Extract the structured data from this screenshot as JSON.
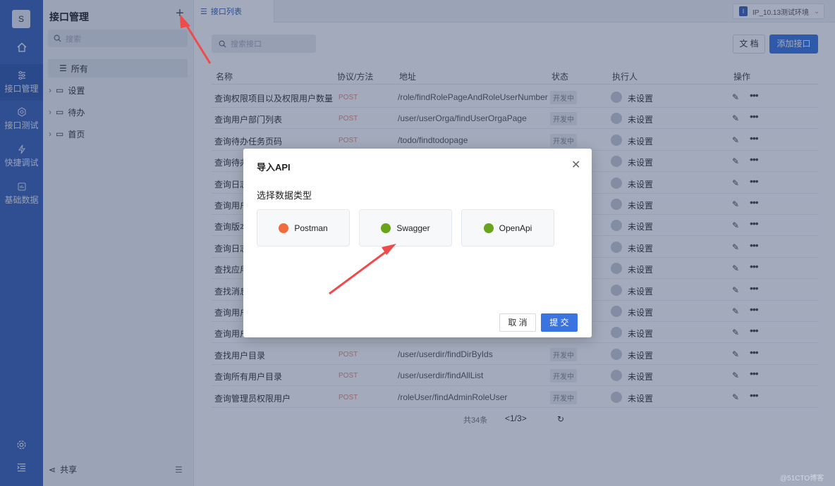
{
  "rail": {
    "avatar": "S",
    "items": [
      {
        "label": "接口管理",
        "icon": "sliders-icon"
      },
      {
        "label": "接口测试",
        "icon": "gear-box-icon"
      },
      {
        "label": "快捷调试",
        "icon": "lightning-icon"
      },
      {
        "label": "基础数据",
        "icon": "database-icon"
      }
    ]
  },
  "sidebar": {
    "title": "接口管理",
    "search_placeholder": "搜索",
    "all_label": "所有",
    "nodes": [
      "设置",
      "待办",
      "首页"
    ],
    "share_label": "共享"
  },
  "tabs": {
    "active": "接口列表",
    "env": "IP_10.13测试环境",
    "env_badge": "I"
  },
  "main": {
    "search_placeholder": "搜索接口",
    "doc_button": "文 档",
    "add_button": "添加接口",
    "columns": [
      "名称",
      "协议/方法",
      "地址",
      "状态",
      "执行人",
      "操作"
    ],
    "rows": [
      {
        "name": "查询权限项目以及权限用户数量",
        "method": "POST",
        "path": "/role/findRolePageAndRoleUserNumber",
        "status": "开发中",
        "executor": "未设置"
      },
      {
        "name": "查询用户部门列表",
        "method": "POST",
        "path": "/user/userOrga/findUserOrgaPage",
        "status": "开发中",
        "executor": "未设置"
      },
      {
        "name": "查询待办任务页码",
        "method": "POST",
        "path": "/todo/findtodopage",
        "status": "开发中",
        "executor": "未设置"
      },
      {
        "name": "查询待办",
        "method": "",
        "path": "",
        "status": "",
        "executor": "未设置"
      },
      {
        "name": "查询日志",
        "method": "",
        "path": "",
        "status": "",
        "executor": "未设置"
      },
      {
        "name": "查询用户",
        "method": "",
        "path": "",
        "status": "",
        "executor": "未设置"
      },
      {
        "name": "查询版本",
        "method": "",
        "path": "",
        "status": "",
        "executor": "未设置"
      },
      {
        "name": "查询日志",
        "method": "",
        "path": "",
        "status": "",
        "executor": "未设置"
      },
      {
        "name": "查找应用",
        "method": "",
        "path": "",
        "status": "",
        "executor": "未设置"
      },
      {
        "name": "查找消息",
        "method": "",
        "path": "",
        "status": "",
        "executor": "未设置"
      },
      {
        "name": "查询用户",
        "method": "",
        "path": "",
        "status": "",
        "executor": "未设置"
      },
      {
        "name": "查询用户",
        "method": "",
        "path": "",
        "status": "",
        "executor": "未设置"
      },
      {
        "name": "查找用户目录",
        "method": "POST",
        "path": "/user/userdir/findDirByIds",
        "status": "开发中",
        "executor": "未设置"
      },
      {
        "name": "查询所有用户目录",
        "method": "POST",
        "path": "/user/userdir/findAllList",
        "status": "开发中",
        "executor": "未设置"
      },
      {
        "name": "查询管理员权限用户",
        "method": "POST",
        "path": "/roleUser/findAdminRoleUser",
        "status": "开发中",
        "executor": "未设置"
      }
    ],
    "pager_total": "共34条",
    "pager_nav": "<1/3>"
  },
  "modal": {
    "title": "导入API",
    "subtitle": "选择数据类型",
    "options": [
      {
        "label": "Postman",
        "icon": "postman-icon",
        "color": "#f26b3a"
      },
      {
        "label": "Swagger",
        "icon": "swagger-icon",
        "color": "#6aa419"
      },
      {
        "label": "OpenApi",
        "icon": "openapi-icon",
        "color": "#6aa419"
      }
    ],
    "cancel": "取 消",
    "submit": "提 交"
  },
  "watermark": "@51CTO博客"
}
